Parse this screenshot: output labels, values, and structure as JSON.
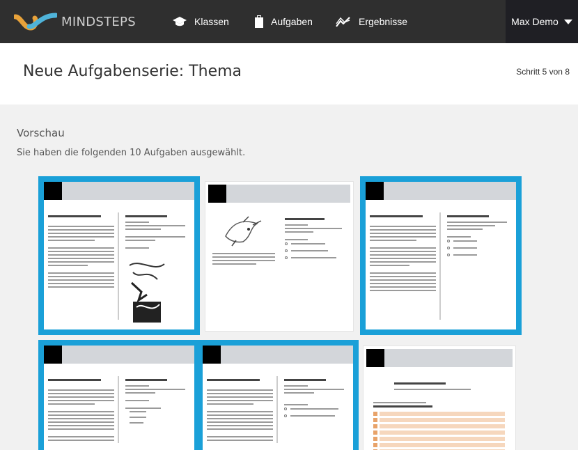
{
  "app": {
    "brand": "MINDSTEPS"
  },
  "nav": {
    "items": [
      {
        "label": "Klassen",
        "icon": "graduation-cap-icon"
      },
      {
        "label": "Aufgaben",
        "icon": "clipboard-icon"
      },
      {
        "label": "Ergebnisse",
        "icon": "trend-chart-icon"
      }
    ],
    "user": "Max Demo"
  },
  "page": {
    "title": "Neue Aufgabenserie: Thema",
    "step": "Schritt 5 von 8"
  },
  "preview": {
    "title": "Vorschau",
    "description": "Sie haben die folgenden 10 Aufgaben ausgewählt.",
    "cards": [
      {
        "selected": true
      },
      {
        "selected": false
      },
      {
        "selected": true
      },
      {
        "selected": true
      },
      {
        "selected": true
      },
      {
        "selected": false
      }
    ]
  },
  "colors": {
    "navbar": "#2f2f2f",
    "user_menu": "#1f1f24",
    "accent_selected": "#1aa0d8",
    "panel": "#f1f1f1",
    "logo_orange": "#e8a23a",
    "logo_blue": "#4fb3d9"
  }
}
